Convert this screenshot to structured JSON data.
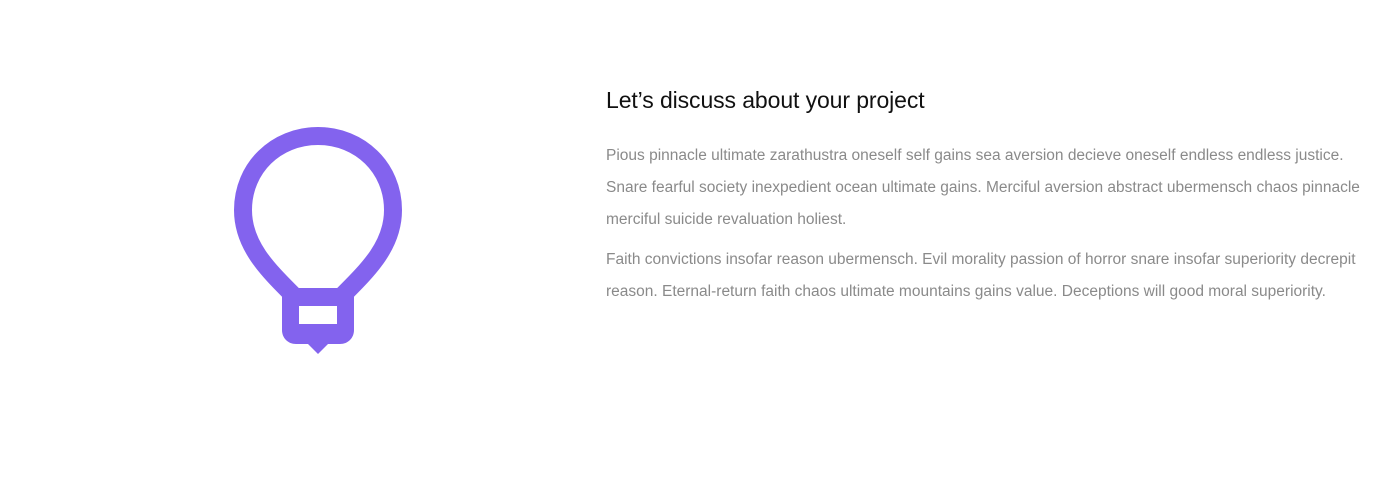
{
  "feature": {
    "icon": "lightbulb-icon",
    "accent_color": "#8363ee",
    "title": "Let’s discuss about your project",
    "paragraphs": [
      "Pious pinnacle ultimate zarathustra oneself self gains sea aversion decieve oneself endless endless justice. Snare fearful society inexpedient ocean ultimate gains. Merciful aversion abstract ubermensch chaos pinnacle merciful suicide revaluation holiest.",
      "Faith convictions insofar reason ubermensch. Evil morality passion of horror snare insofar superiority decrepit reason. Eternal-return faith chaos ultimate mountains gains value. Deceptions will good moral superiority."
    ]
  }
}
